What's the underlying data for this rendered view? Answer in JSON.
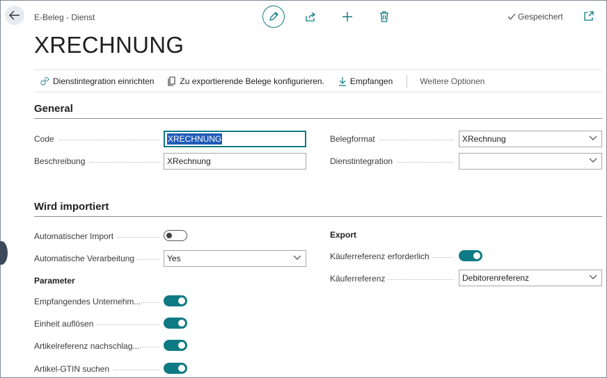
{
  "header": {
    "breadcrumb": "E-Beleg - Dienst",
    "saved_label": "Gespeichert"
  },
  "page": {
    "title": "XRECHNUNG"
  },
  "actions": [
    {
      "label": "Dienstintegration einrichten",
      "icon": "gears-icon"
    },
    {
      "label": "Zu exportierende Belege konfigurieren.",
      "icon": "document-copy-icon"
    },
    {
      "label": "Empfangen",
      "icon": "download-icon"
    },
    {
      "label": "Weitere Optionen",
      "icon": ""
    }
  ],
  "general": {
    "title": "General",
    "code_label": "Code",
    "code_value": "XRECHNUNG",
    "beschreibung_label": "Beschreibung",
    "beschreibung_value": "XRechnung",
    "belegformat_label": "Belegformat",
    "belegformat_value": "XRechnung",
    "dienstintegration_label": "Dienstintegration",
    "dienstintegration_value": ""
  },
  "imported": {
    "title": "Wird importiert",
    "auto_import_label": "Automatischer Import",
    "auto_import_on": false,
    "auto_processing_label": "Automatische Verarbeitung",
    "auto_processing_value": "Yes",
    "parameter_heading": "Parameter",
    "params": [
      {
        "label": "Empfangendes Unternehm...",
        "on": true
      },
      {
        "label": "Einheit auflösen",
        "on": true
      },
      {
        "label": "Artikelreferenz nachschlag...",
        "on": true
      },
      {
        "label": "Artikel-GTIN suchen",
        "on": true
      }
    ],
    "export_heading": "Export",
    "buyer_ref_required_label": "Käuferreferenz erforderlich",
    "buyer_ref_required_on": true,
    "buyer_ref_label": "Käuferreferenz",
    "buyer_ref_value": "Debitorenreferenz"
  },
  "colors": {
    "accent": "#0e7a83",
    "selection": "#1f5bb8"
  }
}
